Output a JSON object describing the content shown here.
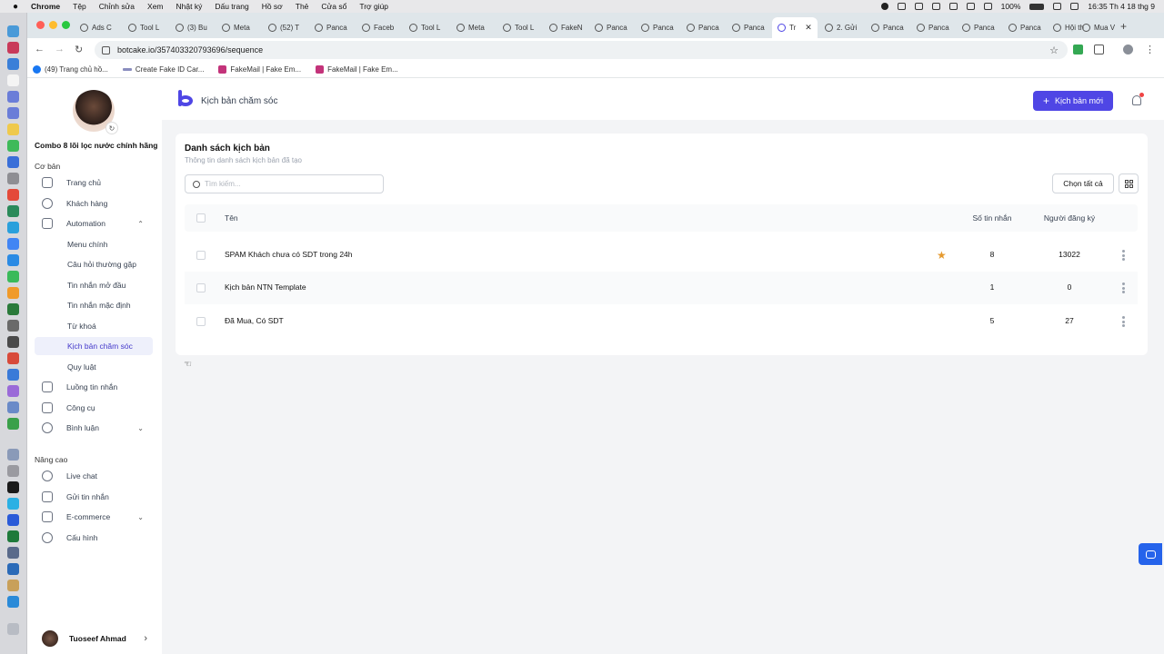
{
  "menubar": {
    "app": "Chrome",
    "items": [
      "Tệp",
      "Chỉnh sửa",
      "Xem",
      "Nhật ký",
      "Dấu trang",
      "Hồ sơ",
      "Thẻ",
      "Cửa sổ",
      "Trợ giúp"
    ],
    "battery": "100%",
    "clock": "16:35 Th 4 18 thg 9"
  },
  "tabs": [
    {
      "label": "Ads C"
    },
    {
      "label": "Tool L"
    },
    {
      "label": "(3) Bu"
    },
    {
      "label": "Meta"
    },
    {
      "label": "(52) T"
    },
    {
      "label": "Panca"
    },
    {
      "label": "Faceb"
    },
    {
      "label": "Tool L"
    },
    {
      "label": "Meta"
    },
    {
      "label": "Tool L"
    },
    {
      "label": "FakeN"
    },
    {
      "label": "Panca"
    },
    {
      "label": "Panca"
    },
    {
      "label": "Panca"
    },
    {
      "label": "Panca"
    },
    {
      "label": "Tr",
      "active": true
    },
    {
      "label": "2. Gửi"
    },
    {
      "label": "Panca"
    },
    {
      "label": "Panca"
    },
    {
      "label": "Panca"
    },
    {
      "label": "Panca"
    },
    {
      "label": "Hội th"
    },
    {
      "label": "Mua V"
    }
  ],
  "address": {
    "url": "botcake.io/357403320793696/sequence"
  },
  "bookmarks": [
    {
      "label": "(49) Trang chủ hồ...",
      "icon": "facebook-icon"
    },
    {
      "label": "Create Fake ID Car...",
      "icon": "card-icon"
    },
    {
      "label": "FakeMail | Fake Em...",
      "icon": "fakemail-icon"
    },
    {
      "label": "FakeMail | Fake Em...",
      "icon": "fakemail-icon"
    }
  ],
  "sidebar": {
    "shop_name": "Combo 8 lõi lọc nước chính hãng",
    "section_basic": "Cơ bản",
    "items": [
      {
        "label": "Trang chủ",
        "icon": "home-icon"
      },
      {
        "label": "Khách hàng",
        "icon": "user-icon"
      },
      {
        "label": "Automation",
        "icon": "automation-icon",
        "expanded": true
      }
    ],
    "automation_sub": [
      {
        "label": "Menu chính"
      },
      {
        "label": "Câu hỏi thường gặp"
      },
      {
        "label": "Tin nhắn mở đầu"
      },
      {
        "label": "Tin nhắn mặc định"
      },
      {
        "label": "Từ khoá"
      },
      {
        "label": "Kịch bản chăm sóc",
        "active": true
      },
      {
        "label": "Quy luật"
      }
    ],
    "items2": [
      {
        "label": "Luồng tin nhắn",
        "icon": "flow-icon"
      },
      {
        "label": "Công cụ",
        "icon": "tools-icon"
      },
      {
        "label": "Bình luận",
        "icon": "comment-icon"
      }
    ],
    "section_advanced": "Nâng cao",
    "advanced": [
      {
        "label": "Live chat",
        "icon": "chat-icon"
      },
      {
        "label": "Gửi tin nhắn",
        "icon": "send-icon"
      },
      {
        "label": "E-commerce",
        "icon": "ecommerce-icon"
      },
      {
        "label": "Cấu hình",
        "icon": "settings-icon"
      }
    ],
    "user_name": "Tuoseef Ahmad"
  },
  "header": {
    "title": "Kịch bản chăm sóc",
    "new_button": "Kịch bản mới"
  },
  "list": {
    "title": "Danh sách kịch bản",
    "subtitle": "Thông tin danh sách kịch bản đã tạo",
    "search_placeholder": "Tìm kiếm...",
    "select_all": "Chọn tất cả",
    "columns": {
      "name": "Tên",
      "messages": "Số tin nhắn",
      "subscribers": "Người đăng ký"
    },
    "rows": [
      {
        "name": "SPAM Khách chưa có SDT trong 24h",
        "messages": "8",
        "subscribers": "13022",
        "starred": true
      },
      {
        "name": "Kịch bản NTN Template",
        "messages": "1",
        "subscribers": "0",
        "starred": false
      },
      {
        "name": "Đã Mua, Có SDT",
        "messages": "5",
        "subscribers": "27",
        "starred": false
      }
    ]
  },
  "colors": {
    "accent": "#4f46e5",
    "star": "#e59a2f",
    "chat_fab": "#2563eb"
  }
}
